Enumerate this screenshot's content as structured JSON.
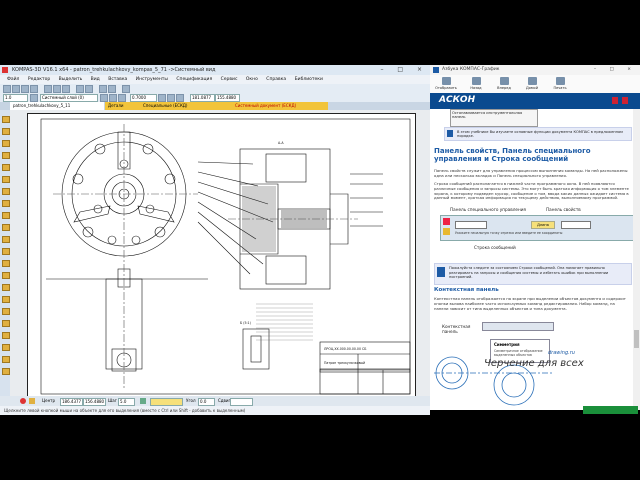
{
  "kompas": {
    "title": "KOMPAS-3D V16.1 x64 - patron_trehkulachkovy_kompas_5_71 ->Системный вид",
    "window_buttons": "– □ ×",
    "menu": [
      "Файл",
      "Редактор",
      "Выделить",
      "Вид",
      "Вставка",
      "Инструменты",
      "Спецификация",
      "Сервис",
      "Окно",
      "Справка",
      "Библиотеки"
    ],
    "toolbar": {
      "scale_value": "1.0",
      "view_value": "Системный слой (0)",
      "zoom_value": "0.7000",
      "coord_x": "181.0877",
      "coord_y": "155.4880"
    },
    "tabs": [
      "patron_trehkulachkovy_5_11",
      "Детали",
      "Специальные (ЕСКД)",
      "Системный документ (ЕСКД)"
    ],
    "status": {
      "center_label": "Центр",
      "center_x": "186.4377",
      "center_y": "156.4880",
      "step_label": "Шаг",
      "step_value": "5.0",
      "angle_label": "Угол",
      "angle_value": "0.0",
      "shift_label": "Сдвиг"
    },
    "status_hint": "Щелкните левой кнопкой мыши на объекте для его выделения (вместе с Ctrl или Shift - добавить к выделенным)",
    "drawing": {
      "section_label": "А-А",
      "detail_label": "Б (5:1)",
      "stamp_title": "Патрон трехкулачковый",
      "stamp_code": "ЛРОЦ.ХХ.000.00.00.00 СБ"
    }
  },
  "help": {
    "title": "Азбука КОМПАС-График",
    "toolbar": [
      "Отобразить",
      "Назад",
      "Вперед",
      "Домой",
      "Печать"
    ],
    "logo": "АСКОН",
    "tooltip": "Останавливается инструментальная панель",
    "note1": "В этом учебнике Вы изучаете основные функции документа КОМПАС в предложенном порядке.",
    "heading": "Панель свойств, Панель специального управления и Строка сообщений",
    "para1": "Панель свойств служит для управления процессом выполнения команды. На ней расположены одна или несколько вкладок и Панель специального управления.",
    "para2": "Строка сообщений располагается в нижней части программного окна. В ней появляются различные сообщения и запросы системы. Это могут быть краткая информация о том элементе экрана, к которому подведен курсор, сообщение о том, ввода каких данных ожидает система в данный момент, краткая информация по текущему действию, выполняемому программой.",
    "label_special": "Панель специального управления",
    "label_props": "Панель свойств",
    "label_msgline": "Строка сообщений",
    "props_tab": "Длина",
    "props_msg": "Укажите начальную точку отрезка или введите ее координаты",
    "note2": "Пожалуйста следите за состоянием Строки сообщений. Она помогает правильно реагировать на запросы и сообщения системы и избегать ошибок при выполнении построений.",
    "subheading": "Контекстная панель",
    "para3": "Контекстная панель отображается на экране при выделении объектов документа и содержит кнопки вызова наиболее часто используемых команд редактирования. Набор команд, на панели зависит от типа выделенных объектов и типа документа.",
    "label_ctx": "Контекстная панель",
    "ctx_item": "Симметрия",
    "ctx_desc": "Симметричное отображение выделенных объектов"
  },
  "watermark": {
    "text": "Черчение для всех",
    "url": "drawing.ru"
  }
}
